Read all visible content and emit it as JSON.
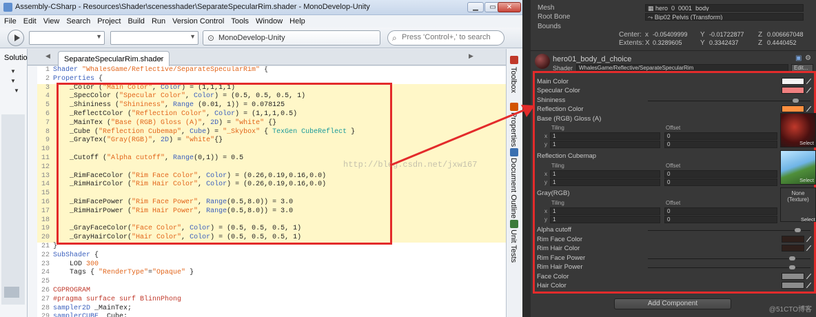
{
  "window": {
    "title": "Assembly-CSharp - Resources\\Shader\\scenesshader\\SeparateSpecularRim.shader - MonoDevelop-Unity",
    "minimize": "▁",
    "maximize": "▭",
    "close": "✕"
  },
  "menu": [
    "File",
    "Edit",
    "View",
    "Search",
    "Project",
    "Build",
    "Run",
    "Version Control",
    "Tools",
    "Window",
    "Help"
  ],
  "toolbar": {
    "status": "MonoDevelop-Unity",
    "search_placeholder": "Press 'Control+,' to search"
  },
  "solution_label": "Solutio",
  "editor_tab": "SeparateSpecularRim.shader",
  "side_pads": [
    "Toolbox",
    "Properties",
    "Document Outline",
    "Unit Tests"
  ],
  "code_lines": [
    {
      "n": "1",
      "parts": [
        [
          "kw",
          "Shader "
        ],
        [
          "str",
          "\"WhalesGame/Reflective/SeparateSpecularRim\""
        ],
        [
          "brk",
          " {"
        ]
      ]
    },
    {
      "n": "2",
      "parts": [
        [
          "kw",
          "Properties"
        ],
        [
          "brk",
          " {"
        ]
      ]
    },
    {
      "n": "3",
      "parts": [
        [
          "",
          "    _Color ("
        ],
        [
          "str",
          "\"Main Color\""
        ],
        [
          "",
          ", "
        ],
        [
          "kw",
          "Color"
        ],
        [
          "",
          ") = (1,1,1,1)"
        ]
      ]
    },
    {
      "n": "4",
      "parts": [
        [
          "",
          "    _SpecColor ("
        ],
        [
          "str",
          "\"Specular Color\""
        ],
        [
          "",
          ", "
        ],
        [
          "kw",
          "Color"
        ],
        [
          "",
          ") = (0.5, 0.5, 0.5, 1)"
        ]
      ]
    },
    {
      "n": "5",
      "parts": [
        [
          "",
          "    _Shininess ("
        ],
        [
          "str",
          "\"Shininess\""
        ],
        [
          "",
          ", "
        ],
        [
          "kw",
          "Range"
        ],
        [
          "",
          " (0.01, 1)) = 0.078125"
        ]
      ]
    },
    {
      "n": "6",
      "parts": [
        [
          "",
          "    _ReflectColor ("
        ],
        [
          "str",
          "\"Reflection Color\""
        ],
        [
          "",
          ", "
        ],
        [
          "kw",
          "Color"
        ],
        [
          "",
          ") = (1,1,1,0.5)"
        ]
      ]
    },
    {
      "n": "7",
      "parts": [
        [
          "",
          "    _MainTex ("
        ],
        [
          "str",
          "\"Base (RGB) Gloss (A)\""
        ],
        [
          "",
          ", "
        ],
        [
          "kw",
          "2D"
        ],
        [
          "",
          ") = "
        ],
        [
          "str",
          "\"white\""
        ],
        [
          "",
          " {}"
        ]
      ]
    },
    {
      "n": "8",
      "parts": [
        [
          "",
          "    _Cube ("
        ],
        [
          "str",
          "\"Reflection Cubemap\""
        ],
        [
          "",
          ", "
        ],
        [
          "kw",
          "Cube"
        ],
        [
          "",
          ") = "
        ],
        [
          "str",
          "\"_Skybox\""
        ],
        [
          "",
          " { "
        ],
        [
          "teal",
          "TexGen CubeReflect"
        ],
        [
          "",
          " }"
        ]
      ]
    },
    {
      "n": "9",
      "parts": [
        [
          "",
          "    _GrayTex("
        ],
        [
          "str",
          "\"Gray(RGB)\""
        ],
        [
          "",
          ", "
        ],
        [
          "kw",
          "2D"
        ],
        [
          "",
          ") = "
        ],
        [
          "str",
          "\"white\""
        ],
        [
          "",
          "{}"
        ]
      ]
    },
    {
      "n": "10",
      "parts": [
        [
          "",
          ""
        ]
      ]
    },
    {
      "n": "11",
      "parts": [
        [
          "",
          "    _Cutoff ("
        ],
        [
          "str",
          "\"Alpha cutoff\""
        ],
        [
          "",
          ", "
        ],
        [
          "kw",
          "Range"
        ],
        [
          "",
          "(0,1)) = 0.5"
        ]
      ]
    },
    {
      "n": "12",
      "parts": [
        [
          "",
          ""
        ]
      ]
    },
    {
      "n": "13",
      "parts": [
        [
          "",
          "    _RimFaceColor ("
        ],
        [
          "str",
          "\"Rim Face Color\""
        ],
        [
          "",
          ", "
        ],
        [
          "kw",
          "Color"
        ],
        [
          "",
          ") = (0.26,0.19,0.16,0.0)"
        ]
      ]
    },
    {
      "n": "14",
      "parts": [
        [
          "",
          "    _RimHairColor ("
        ],
        [
          "str",
          "\"Rim Hair Color\""
        ],
        [
          "",
          ", "
        ],
        [
          "kw",
          "Color"
        ],
        [
          "",
          ") = (0.26,0.19,0.16,0.0)"
        ]
      ]
    },
    {
      "n": "15",
      "parts": [
        [
          "",
          ""
        ]
      ]
    },
    {
      "n": "16",
      "parts": [
        [
          "",
          "    _RimFacePower ("
        ],
        [
          "str",
          "\"Rim Face Power\""
        ],
        [
          "",
          ", "
        ],
        [
          "kw",
          "Range"
        ],
        [
          "",
          "(0.5,8.0)) = 3.0"
        ]
      ]
    },
    {
      "n": "17",
      "parts": [
        [
          "",
          "    _RimHairPower ("
        ],
        [
          "str",
          "\"Rim Hair Power\""
        ],
        [
          "",
          ", "
        ],
        [
          "kw",
          "Range"
        ],
        [
          "",
          "(0.5,8.0)) = 3.0"
        ]
      ]
    },
    {
      "n": "18",
      "parts": [
        [
          "",
          ""
        ]
      ]
    },
    {
      "n": "19",
      "parts": [
        [
          "",
          "    _GrayFaceColor("
        ],
        [
          "str",
          "\"Face Color\""
        ],
        [
          "",
          ", "
        ],
        [
          "kw",
          "Color"
        ],
        [
          "",
          ") = (0.5, 0.5, 0.5, 1)"
        ]
      ]
    },
    {
      "n": "20",
      "parts": [
        [
          "",
          "    _GrayHairColor("
        ],
        [
          "str",
          "\"Hair Color\""
        ],
        [
          "",
          ", "
        ],
        [
          "kw",
          "Color"
        ],
        [
          "",
          ") = (0.5, 0.5, 0.5, 1)"
        ]
      ]
    },
    {
      "n": "21",
      "parts": [
        [
          "brk",
          "}"
        ]
      ]
    },
    {
      "n": "22",
      "parts": [
        [
          "kw",
          "SubShader"
        ],
        [
          "",
          " {"
        ]
      ]
    },
    {
      "n": "23",
      "parts": [
        [
          "",
          "    LOD "
        ],
        [
          "str",
          "300"
        ]
      ]
    },
    {
      "n": "24",
      "parts": [
        [
          "",
          "    Tags { "
        ],
        [
          "str",
          "\"RenderType\""
        ],
        [
          "",
          "="
        ],
        [
          "str",
          "\"Opaque\""
        ],
        [
          "",
          " }"
        ]
      ]
    },
    {
      "n": "25",
      "parts": [
        [
          "",
          ""
        ]
      ]
    },
    {
      "n": "26",
      "parts": [
        [
          "pp",
          "CGPROGRAM"
        ]
      ]
    },
    {
      "n": "27",
      "parts": [
        [
          "pp",
          "#pragma surface surf BlinnPhong"
        ]
      ]
    },
    {
      "n": "28",
      "parts": [
        [
          "kw",
          "sampler2D"
        ],
        [
          "",
          " _MainTex;"
        ]
      ]
    },
    {
      "n": "29",
      "parts": [
        [
          "kw",
          "samplerCUBE"
        ],
        [
          "",
          " _Cube;"
        ]
      ]
    }
  ],
  "watermark": "http://blog.csdn.net/jxw167",
  "inspector": {
    "mesh_label": "Mesh",
    "mesh_value": "hero_0_0001_body",
    "root_bone_label": "Root Bone",
    "root_bone_value": "Bip02 Pelvis (Transform)",
    "bounds_label": "Bounds",
    "center_label": "Center:",
    "center": {
      "x": "-0.05409999",
      "y": "-0.01722877",
      "z": "0.006667048"
    },
    "extents_label": "Extents:",
    "extents": {
      "x": "0.3289605",
      "y": "0.3342437",
      "z": "0.4440452"
    },
    "material_name": "hero01_body_d_choice",
    "shader_label": "Shader",
    "shader_value": "WhalesGame/Reflective/SeparateSpecularRim",
    "edit_label": "Edit...",
    "properties": {
      "main_color": "Main Color",
      "spec_color": "Specular Color",
      "shininess": "Shininess",
      "reflection_color": "Reflection Color",
      "base_tex": "Base (RGB) Gloss (A)",
      "reflection_cube": "Reflection Cubemap",
      "gray": "Gray(RGB)",
      "alpha_cutoff": "Alpha cutoff",
      "rim_face_color": "Rim Face Color",
      "rim_hair_color": "Rim Hair Color",
      "rim_face_power": "Rim Face Power",
      "rim_hair_power": "Rim Hair Power",
      "face_color": "Face Color",
      "hair_color": "Hair Color"
    },
    "tiling_label": "Tiling",
    "offset_label": "Offset",
    "x_label": "x",
    "y_label": "y",
    "tiling_value": "1",
    "offset_value": "0",
    "select_label": "Select",
    "none_texture": "None\n(Texture)",
    "add_component": "Add Component",
    "watermark": "@51CTO博客"
  },
  "colors": {
    "highlight_box": "#e32b2b",
    "main_color": "#f4f4f4",
    "spec_color": "#f08080",
    "reflection_color": "#ff9040",
    "rim_face_color": "#2e1f1b",
    "rim_hair_color": "#2e1f1b",
    "face_color": "#8c8c8c",
    "hair_color": "#8c8c8c"
  }
}
